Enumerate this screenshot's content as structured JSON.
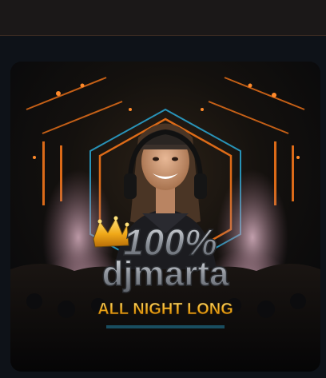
{
  "topbar": {},
  "poster": {
    "badge_text": "100%",
    "artist_text": "djmarta",
    "headline_text": "ALL NIGHT LONG",
    "colors": {
      "accent_orange": "#ff7a1a",
      "accent_cyan": "#2ec8ff",
      "gold": "#f3b21c",
      "silver": "#b9bcc2"
    }
  }
}
